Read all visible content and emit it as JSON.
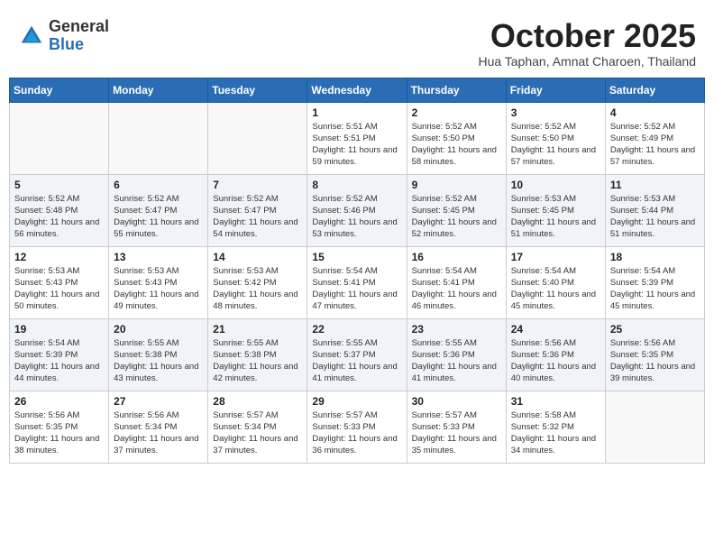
{
  "header": {
    "logo_general": "General",
    "logo_blue": "Blue",
    "month_title": "October 2025",
    "location": "Hua Taphan, Amnat Charoen, Thailand"
  },
  "weekdays": [
    "Sunday",
    "Monday",
    "Tuesday",
    "Wednesday",
    "Thursday",
    "Friday",
    "Saturday"
  ],
  "weeks": [
    [
      {
        "day": "",
        "info": ""
      },
      {
        "day": "",
        "info": ""
      },
      {
        "day": "",
        "info": ""
      },
      {
        "day": "1",
        "info": "Sunrise: 5:51 AM\nSunset: 5:51 PM\nDaylight: 11 hours and 59 minutes."
      },
      {
        "day": "2",
        "info": "Sunrise: 5:52 AM\nSunset: 5:50 PM\nDaylight: 11 hours and 58 minutes."
      },
      {
        "day": "3",
        "info": "Sunrise: 5:52 AM\nSunset: 5:50 PM\nDaylight: 11 hours and 57 minutes."
      },
      {
        "day": "4",
        "info": "Sunrise: 5:52 AM\nSunset: 5:49 PM\nDaylight: 11 hours and 57 minutes."
      }
    ],
    [
      {
        "day": "5",
        "info": "Sunrise: 5:52 AM\nSunset: 5:48 PM\nDaylight: 11 hours and 56 minutes."
      },
      {
        "day": "6",
        "info": "Sunrise: 5:52 AM\nSunset: 5:47 PM\nDaylight: 11 hours and 55 minutes."
      },
      {
        "day": "7",
        "info": "Sunrise: 5:52 AM\nSunset: 5:47 PM\nDaylight: 11 hours and 54 minutes."
      },
      {
        "day": "8",
        "info": "Sunrise: 5:52 AM\nSunset: 5:46 PM\nDaylight: 11 hours and 53 minutes."
      },
      {
        "day": "9",
        "info": "Sunrise: 5:52 AM\nSunset: 5:45 PM\nDaylight: 11 hours and 52 minutes."
      },
      {
        "day": "10",
        "info": "Sunrise: 5:53 AM\nSunset: 5:45 PM\nDaylight: 11 hours and 51 minutes."
      },
      {
        "day": "11",
        "info": "Sunrise: 5:53 AM\nSunset: 5:44 PM\nDaylight: 11 hours and 51 minutes."
      }
    ],
    [
      {
        "day": "12",
        "info": "Sunrise: 5:53 AM\nSunset: 5:43 PM\nDaylight: 11 hours and 50 minutes."
      },
      {
        "day": "13",
        "info": "Sunrise: 5:53 AM\nSunset: 5:43 PM\nDaylight: 11 hours and 49 minutes."
      },
      {
        "day": "14",
        "info": "Sunrise: 5:53 AM\nSunset: 5:42 PM\nDaylight: 11 hours and 48 minutes."
      },
      {
        "day": "15",
        "info": "Sunrise: 5:54 AM\nSunset: 5:41 PM\nDaylight: 11 hours and 47 minutes."
      },
      {
        "day": "16",
        "info": "Sunrise: 5:54 AM\nSunset: 5:41 PM\nDaylight: 11 hours and 46 minutes."
      },
      {
        "day": "17",
        "info": "Sunrise: 5:54 AM\nSunset: 5:40 PM\nDaylight: 11 hours and 45 minutes."
      },
      {
        "day": "18",
        "info": "Sunrise: 5:54 AM\nSunset: 5:39 PM\nDaylight: 11 hours and 45 minutes."
      }
    ],
    [
      {
        "day": "19",
        "info": "Sunrise: 5:54 AM\nSunset: 5:39 PM\nDaylight: 11 hours and 44 minutes."
      },
      {
        "day": "20",
        "info": "Sunrise: 5:55 AM\nSunset: 5:38 PM\nDaylight: 11 hours and 43 minutes."
      },
      {
        "day": "21",
        "info": "Sunrise: 5:55 AM\nSunset: 5:38 PM\nDaylight: 11 hours and 42 minutes."
      },
      {
        "day": "22",
        "info": "Sunrise: 5:55 AM\nSunset: 5:37 PM\nDaylight: 11 hours and 41 minutes."
      },
      {
        "day": "23",
        "info": "Sunrise: 5:55 AM\nSunset: 5:36 PM\nDaylight: 11 hours and 41 minutes."
      },
      {
        "day": "24",
        "info": "Sunrise: 5:56 AM\nSunset: 5:36 PM\nDaylight: 11 hours and 40 minutes."
      },
      {
        "day": "25",
        "info": "Sunrise: 5:56 AM\nSunset: 5:35 PM\nDaylight: 11 hours and 39 minutes."
      }
    ],
    [
      {
        "day": "26",
        "info": "Sunrise: 5:56 AM\nSunset: 5:35 PM\nDaylight: 11 hours and 38 minutes."
      },
      {
        "day": "27",
        "info": "Sunrise: 5:56 AM\nSunset: 5:34 PM\nDaylight: 11 hours and 37 minutes."
      },
      {
        "day": "28",
        "info": "Sunrise: 5:57 AM\nSunset: 5:34 PM\nDaylight: 11 hours and 37 minutes."
      },
      {
        "day": "29",
        "info": "Sunrise: 5:57 AM\nSunset: 5:33 PM\nDaylight: 11 hours and 36 minutes."
      },
      {
        "day": "30",
        "info": "Sunrise: 5:57 AM\nSunset: 5:33 PM\nDaylight: 11 hours and 35 minutes."
      },
      {
        "day": "31",
        "info": "Sunrise: 5:58 AM\nSunset: 5:32 PM\nDaylight: 11 hours and 34 minutes."
      },
      {
        "day": "",
        "info": ""
      }
    ]
  ]
}
